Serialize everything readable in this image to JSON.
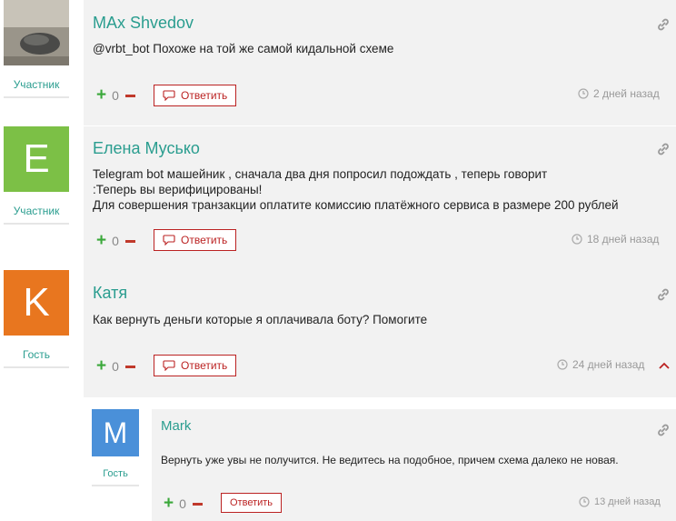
{
  "comments": [
    {
      "author": "MAx Shvedov",
      "role": "Участник",
      "avatar_type": "photo",
      "text_lines": [
        "@vrbt_bot Похоже на той же самой кидальной схеме"
      ],
      "votes": "0",
      "reply_label": "Ответить",
      "date": "2 дней назад"
    },
    {
      "author": "Елена Мусько",
      "role": "Участник",
      "avatar_letter": "E",
      "avatar_color": "#7cc046",
      "text_lines": [
        "Telegram bot машейник , сначала два дня попросил подождать , теперь говорит",
        ":Теперь вы верифицированы!",
        "Для совершения транзакции оплатите комиссию платёжного сервиса в размере 200 рублей"
      ],
      "votes": "0",
      "reply_label": "Ответить",
      "date": "18 дней назад"
    },
    {
      "author": "Катя",
      "role": "Гость",
      "avatar_letter": "K",
      "avatar_color": "#e8761f",
      "text_lines": [
        "Как вернуть деньги которые я оплачивала боту? Помогите"
      ],
      "votes": "0",
      "reply_label": "Ответить",
      "date": "24 дней назад"
    },
    {
      "author": "Mark",
      "role": "Гость",
      "avatar_letter": "M",
      "avatar_color": "#4a90d9",
      "text_lines": [
        "Вернуть уже увы не получится. Не ведитесь на подобное, причем схема далеко не новая."
      ],
      "votes": "0",
      "reply_label": "Ответить",
      "date": "13 дней назад"
    }
  ],
  "colors": {
    "accent": "#2a9d8f",
    "vote_plus": "#3aa83a",
    "vote_minus": "#c0392b",
    "reply_border": "#b22222",
    "card_bg": "#f2f2f2"
  },
  "icons": [
    "link-icon",
    "comment-icon",
    "clock-icon",
    "chevron-up-icon"
  ]
}
